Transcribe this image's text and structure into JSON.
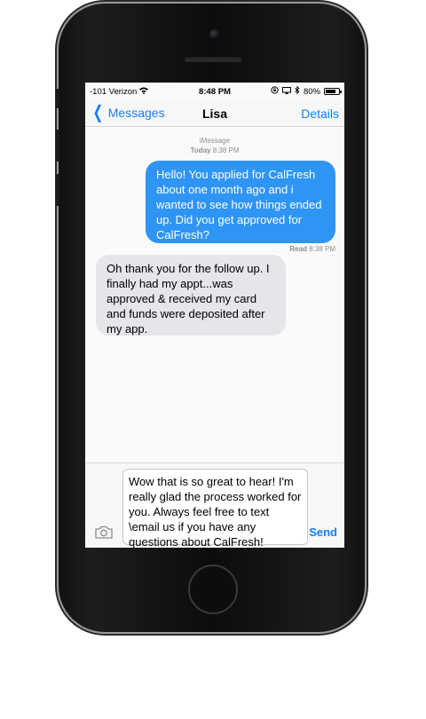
{
  "status": {
    "carrier": "-101 Verizon",
    "time": "8:48 PM",
    "battery": "80%",
    "battery_level": 0.8
  },
  "nav": {
    "back_label": "Messages",
    "title": "Lisa",
    "details_label": "Details"
  },
  "thread": {
    "service": "iMessage",
    "date_label": "Today",
    "date_time": "8:38 PM",
    "messages": [
      {
        "from": "me",
        "text": "Hello! You applied for CalFresh about one month ago and i wanted to see how things ended up. Did you get approved for CalFresh?"
      },
      {
        "from": "them",
        "text": "Oh thank you for the follow up. I finally had my appt...was approved & received my card and funds were deposited after my app."
      }
    ],
    "read_label": "Read",
    "read_time": "8:38 PM"
  },
  "compose": {
    "draft": "Wow that is so great to hear! I'm really glad the process worked for you. Always feel free to text \\email us if you have any questions about CalFresh!",
    "send_label": "Send"
  },
  "colors": {
    "accent": "#147efb",
    "outgoing_bubble": "#2f95f5",
    "incoming_bubble": "#e5e5ea"
  }
}
